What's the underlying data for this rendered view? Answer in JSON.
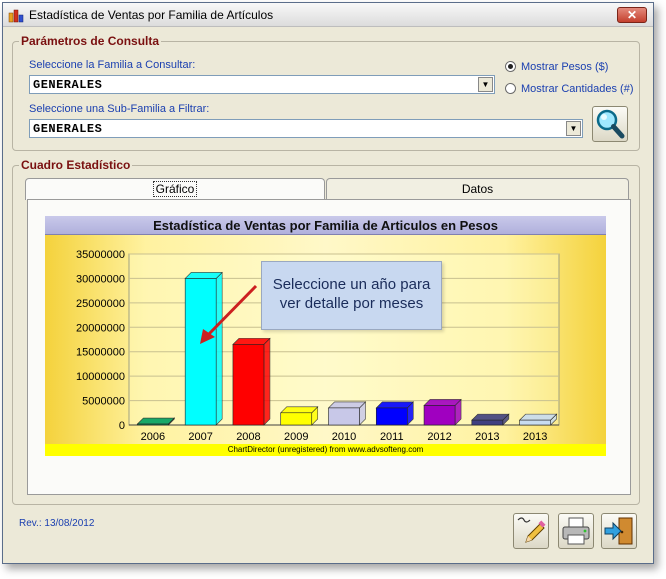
{
  "window": {
    "title": "Estadística de Ventas por Familia de Artículos",
    "close_label": "✕"
  },
  "params": {
    "group_title": "Parámetros de Consulta",
    "familia_label": "Seleccione la Familia a Consultar:",
    "familia_value": "GENERALES",
    "subfamilia_label": "Seleccione una Sub-Familia a Filtrar:",
    "subfamilia_value": "GENERALES",
    "radio_pesos_label": "Mostrar Pesos ($)",
    "radio_cantidades_label": "Mostrar Cantidades (#)",
    "selected_mode": "pesos",
    "search_button_icon": "magnifier-icon"
  },
  "cuadro": {
    "group_title": "Cuadro Estadístico",
    "tabs": [
      {
        "label": "Gráfico",
        "active": true
      },
      {
        "label": "Datos",
        "active": false
      }
    ]
  },
  "chart_data": {
    "type": "bar",
    "title": "Estadística de Ventas por Familia de Articulos en Pesos",
    "categories": [
      "2006",
      "2007",
      "2008",
      "2009",
      "2010",
      "2011",
      "2012",
      "2013",
      "2013"
    ],
    "values": [
      200000,
      30000000,
      16500000,
      2500000,
      3500000,
      3500000,
      4000000,
      1000000,
      1000000
    ],
    "colors": [
      "#00a060",
      "#00ffff",
      "#ff0000",
      "#ffff00",
      "#c8c8e8",
      "#0000ff",
      "#a000c0",
      "#404080",
      "#c8dcf0"
    ],
    "yticks": [
      "0",
      "5000000",
      "10000000",
      "15000000",
      "20000000",
      "25000000",
      "30000000",
      "35000000"
    ],
    "ylim": [
      0,
      35000000
    ],
    "footer": "ChartDirector (unregistered) from www.advsofteng.com",
    "callout": "Seleccione un año para ver detalle por meses"
  },
  "footer": {
    "revision": "Rev.: 13/08/2012",
    "buttons": [
      "edit-pencil-icon",
      "printer-icon",
      "exit-door-icon"
    ]
  },
  "colors": {
    "accent_title": "#7a1010",
    "label_blue": "#1a3fb0",
    "window_bg": "#ece9d8"
  }
}
